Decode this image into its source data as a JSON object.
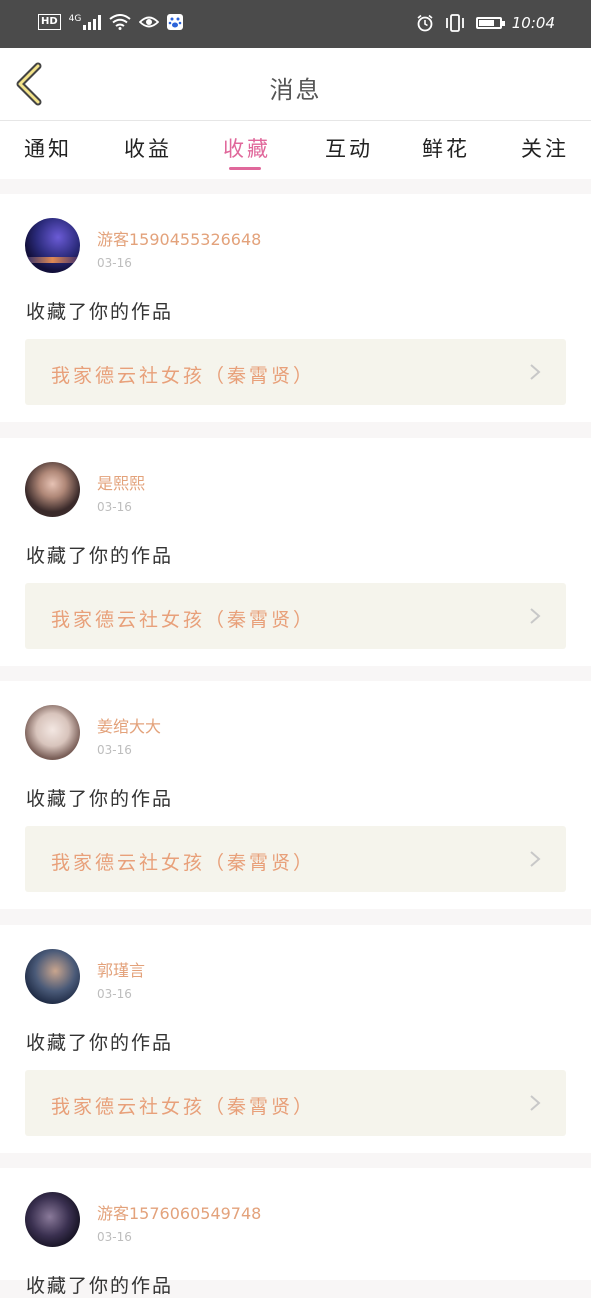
{
  "status_bar": {
    "hd": "HD",
    "network": "4G",
    "time": "10:04",
    "icons": [
      "hd-icon",
      "signal-icon",
      "wifi-icon",
      "eye-icon",
      "baidu-icon",
      "alarm-icon",
      "vibrate-icon",
      "battery-icon"
    ]
  },
  "header": {
    "title": "消息",
    "back_icon": "chevron-left-icon"
  },
  "tabs": [
    {
      "label": "通知"
    },
    {
      "label": "收益"
    },
    {
      "label": "收藏"
    },
    {
      "label": "互动"
    },
    {
      "label": "鲜花"
    },
    {
      "label": "关注"
    }
  ],
  "active_tab": "收藏",
  "colors": {
    "accent": "#e0689b",
    "username": "#e3a27b",
    "work_bg": "#f5f4ec"
  },
  "messages": [
    {
      "user": "游客1590455326648",
      "date": "03-16",
      "action": "收藏了你的作品",
      "work": "我家德云社女孩（秦霄贤）"
    },
    {
      "user": "是熙熙",
      "date": "03-16",
      "action": "收藏了你的作品",
      "work": "我家德云社女孩（秦霄贤）"
    },
    {
      "user": "姜绾大大",
      "date": "03-16",
      "action": "收藏了你的作品",
      "work": "我家德云社女孩（秦霄贤）"
    },
    {
      "user": "郭瑾言",
      "date": "03-16",
      "action": "收藏了你的作品",
      "work": "我家德云社女孩（秦霄贤）"
    },
    {
      "user": "游客1576060549748",
      "date": "03-16",
      "action": "收藏了你的作品",
      "work": ""
    }
  ]
}
